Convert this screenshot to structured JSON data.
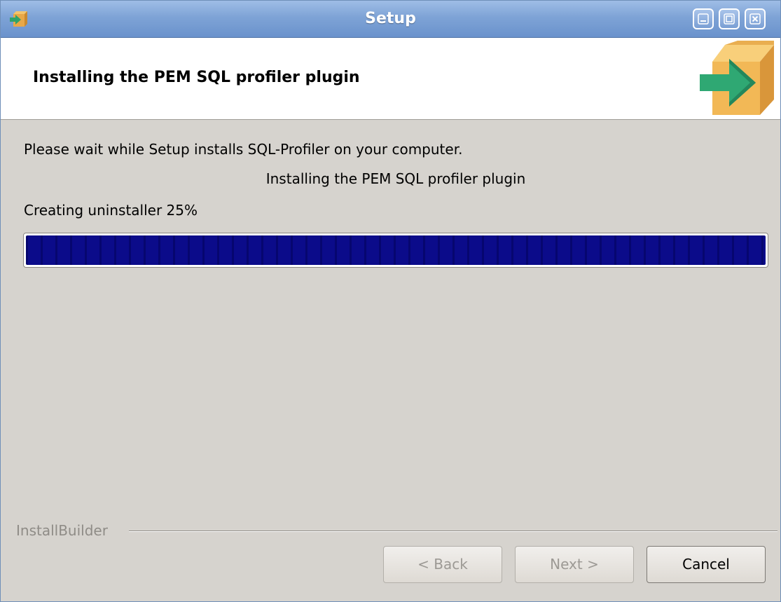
{
  "window": {
    "title": "Setup"
  },
  "header": {
    "title": "Installing the PEM SQL profiler plugin"
  },
  "body": {
    "wait_message": "Please wait while Setup installs SQL-Profiler on your computer.",
    "status_text": "Installing the PEM SQL profiler plugin",
    "progress_label": "Creating uninstaller 25%",
    "progress_percent": 100
  },
  "footer": {
    "brand": "InstallBuilder",
    "back_label": "< Back",
    "next_label": "Next >",
    "cancel_label": "Cancel"
  },
  "icons": {
    "app": "installer-box-arrow-icon",
    "header_logo": "box-arrow-icon",
    "minimize": "minimize-icon",
    "maximize": "maximize-icon",
    "close": "close-icon"
  },
  "colors": {
    "titlebar": "#7ea3d6",
    "progress_fill": "#0a0a84",
    "window_bg": "#d6d3ce"
  }
}
